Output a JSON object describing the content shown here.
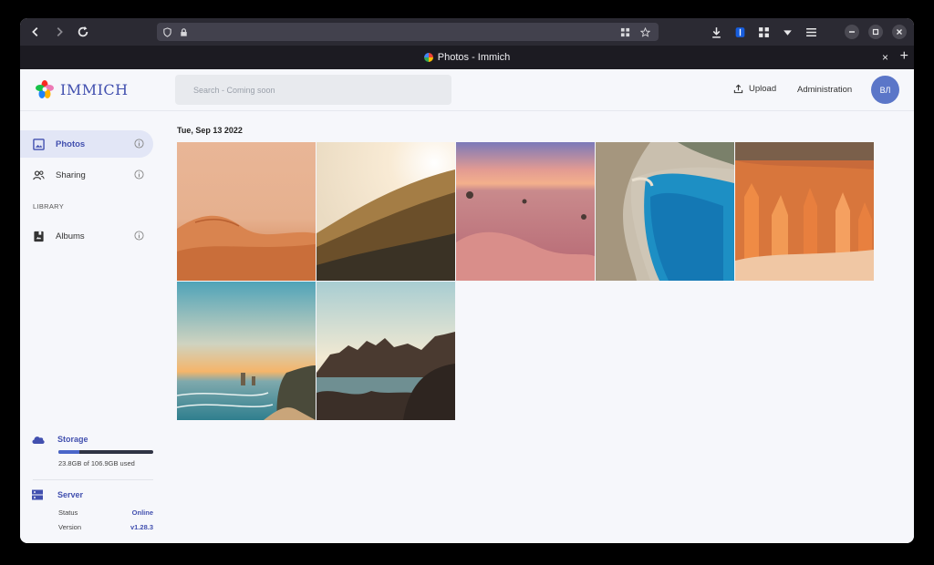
{
  "browser": {
    "tab_title": "Photos - Immich",
    "tab_close": "×",
    "new_tab": "+"
  },
  "app": {
    "logo_text": "IMMICH",
    "search": {
      "placeholder": "Search - Coming soon"
    },
    "header": {
      "upload_label": "Upload",
      "admin_label": "Administration",
      "avatar_initials": "ВЛ"
    },
    "sidebar": {
      "items": [
        {
          "label": "Photos",
          "icon": "photo-icon",
          "active": true
        },
        {
          "label": "Sharing",
          "icon": "people-icon",
          "active": false
        }
      ],
      "section_library": "LIBRARY",
      "library_items": [
        {
          "label": "Albums",
          "icon": "album-icon",
          "active": false
        }
      ],
      "storage": {
        "title": "Storage",
        "used_text": "23.8GB of 106.9GB used",
        "used_fraction": 0.223
      },
      "server": {
        "title": "Server",
        "status_label": "Status",
        "status_value": "Online",
        "version_label": "Version",
        "version_value": "v1.28.3"
      }
    },
    "timeline": {
      "date_heading": "Tue, Sep 13 2022",
      "photos": [
        {
          "name": "desert-dunes"
        },
        {
          "name": "golden-grass-hillside"
        },
        {
          "name": "pink-desert-sunset"
        },
        {
          "name": "navagio-cove"
        },
        {
          "name": "bryce-canyon-hoodoos"
        },
        {
          "name": "twelve-apostles-sunset"
        },
        {
          "name": "rocky-coast-sunset"
        }
      ]
    }
  },
  "colors": {
    "accent": "#4250af",
    "chrome_bg": "#2b2a33",
    "tabbar_bg": "#1c1b22",
    "app_bg": "#f6f7fb",
    "active_nav_bg": "#e2e6f6"
  }
}
